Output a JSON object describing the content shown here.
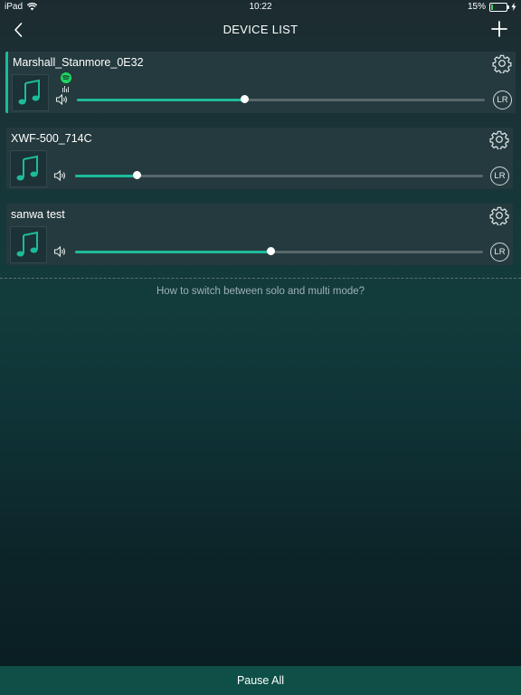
{
  "status_bar": {
    "device": "iPad",
    "time": "10:22",
    "battery_percent": "15%",
    "battery_level": 0.15
  },
  "nav": {
    "title": "DEVICE LIST",
    "back_icon": "chevron-left-icon",
    "add_icon": "plus-icon"
  },
  "devices": [
    {
      "name": "Marshall_Stanmore_0E32",
      "active": true,
      "source": "spotify",
      "volume": 0.41,
      "lr_label": "LR"
    },
    {
      "name": "XWF-500_714C",
      "active": false,
      "volume": 0.15,
      "lr_label": "LR"
    },
    {
      "name": "sanwa test",
      "active": false,
      "volume": 0.48,
      "lr_label": "LR"
    }
  ],
  "help_link": "How to switch between solo and multi mode?",
  "footer": {
    "pause_all_label": "Pause All"
  },
  "colors": {
    "accent": "#1dbb9a",
    "card_bg": "#253a3e",
    "footer_bg": "#0e4f47",
    "spotify": "#1ed760"
  }
}
